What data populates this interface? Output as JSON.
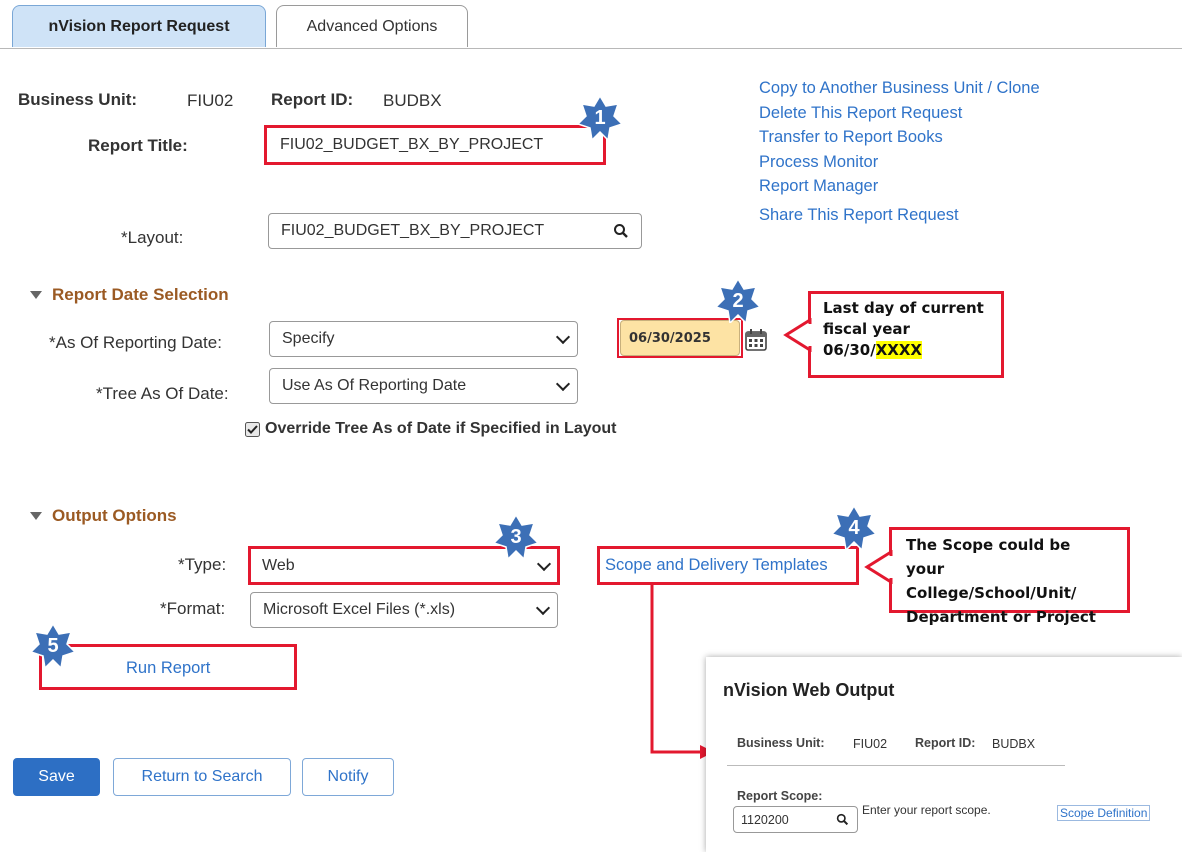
{
  "tabs": [
    {
      "label": "nVision Report Request"
    },
    {
      "label": "Advanced Options"
    }
  ],
  "header": {
    "business_unit_label": "Business Unit:",
    "business_unit_value": "FIU02",
    "report_id_label": "Report ID:",
    "report_id_value": "BUDBX",
    "report_title_label": "Report Title:",
    "report_title_value": "FIU02_BUDGET_BX_BY_PROJECT",
    "layout_label": "*Layout:",
    "layout_value": "FIU02_BUDGET_BX_BY_PROJECT"
  },
  "links": [
    "Copy to Another Business Unit / Clone",
    "Delete This Report Request",
    "Transfer to Report Books",
    "Process Monitor",
    "Report Manager",
    "Share This Report Request"
  ],
  "date_section": {
    "title": "Report Date Selection",
    "as_of_label": "*As Of Reporting Date:",
    "as_of_value": "Specify",
    "date_value": "06/30/2025",
    "tree_label": "*Tree As Of Date:",
    "tree_value": "Use As Of Reporting Date",
    "override_label": "Override Tree As of Date if Specified in Layout",
    "override_checked": true
  },
  "output_section": {
    "title": "Output Options",
    "type_label": "*Type:",
    "type_value": "Web",
    "format_label": "*Format:",
    "format_value": "Microsoft Excel Files (*.xls)",
    "scope_link": "Scope and Delivery Templates",
    "run_report": "Run Report"
  },
  "buttons": {
    "save": "Save",
    "return": "Return to Search",
    "notify": "Notify"
  },
  "callouts": {
    "date_line1": "Last day of current",
    "date_line2": "fiscal year",
    "date_line3_prefix": "06/30/",
    "date_line3_highlight": "XXXX",
    "scope_line1": "The Scope could be your",
    "scope_line2": "College/School/Unit/",
    "scope_line3": "Department or Project"
  },
  "badges": [
    "1",
    "2",
    "3",
    "4",
    "5"
  ],
  "web_output": {
    "title": "nVision Web Output",
    "business_unit_label": "Business Unit:",
    "business_unit_value": "FIU02",
    "report_id_label": "Report ID:",
    "report_id_value": "BUDBX",
    "scope_label": "Report Scope:",
    "scope_value": "1120200",
    "scope_hint": "Enter your report scope.",
    "scope_definition": "Scope Definition"
  },
  "colors": {
    "badge": "#3c6fb6",
    "annotation_red": "#e3182f",
    "link": "#2f73c9",
    "section_title": "#9b5a23",
    "date_field_bg": "#fde3a4"
  },
  "icons": {
    "lookup": "magnifier-icon",
    "calendar": "calendar-icon",
    "collapse": "triangle-down-icon",
    "checkbox": "checkbox-checked-icon"
  }
}
